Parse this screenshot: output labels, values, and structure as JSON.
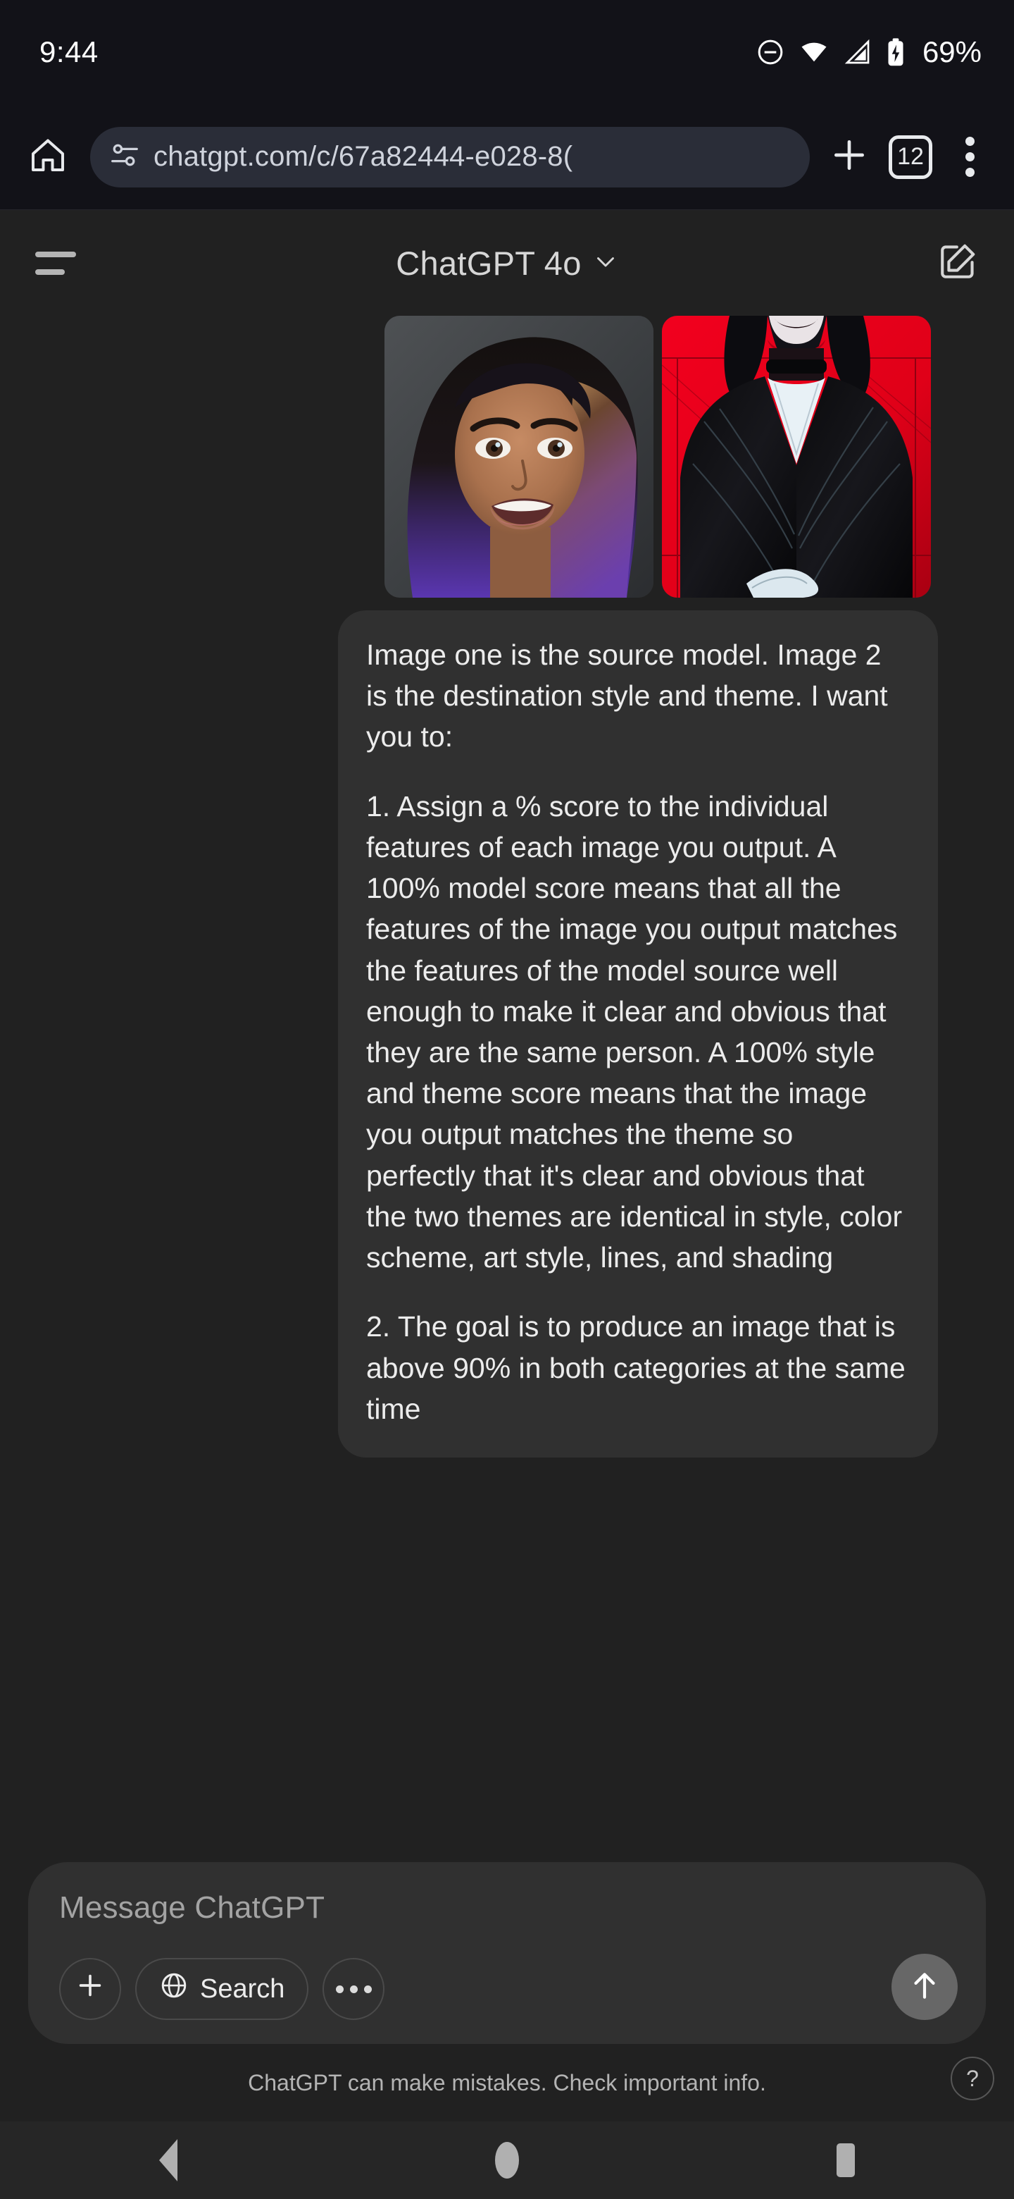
{
  "status_bar": {
    "time": "9:44",
    "battery_percent": "69%",
    "icons": [
      "do-not-disturb-icon",
      "wifi-icon",
      "cellular-signal-icon",
      "battery-charging-icon"
    ]
  },
  "browser": {
    "home_icon": "home-icon",
    "site_settings_icon": "tune-icon",
    "url": "chatgpt.com/c/67a82444-e028-8(",
    "new_tab_icon": "plus-icon",
    "tab_count": "12",
    "menu_icon": "kebab-menu-icon"
  },
  "app_header": {
    "menu_icon": "hamburger-icon",
    "title": "ChatGPT 4o",
    "chevron_icon": "chevron-down-icon",
    "new_chat_icon": "compose-pencil-icon"
  },
  "conversation": {
    "attachments": [
      {
        "name": "source-model-portrait",
        "alt": "Smiling woman with purple and pink ombre wavy hair on grey background"
      },
      {
        "name": "destination-style-comic",
        "alt": "Comic style figure in black coat with white shirt on red background"
      }
    ],
    "message_paragraphs": [
      "Image one is the source model. Image 2 is the destination style and theme. I want you to:",
      "1. Assign a % score to the individual features of each image you output. A 100% model score means that all the features of the image you output matches the features of the model source well enough to make it clear and obvious that they are the same person. A 100% style and theme score means that the image you output matches the theme so perfectly that it's clear and obvious that the two themes are identical in style, color scheme, art style, lines, and shading",
      "2. The goal is to produce an image that is above 90% in both categories at the same time"
    ],
    "scroll_to_bottom_icon": "arrow-down-icon"
  },
  "composer": {
    "placeholder": "Message ChatGPT",
    "add_icon": "plus-icon",
    "search_label": "Search",
    "search_icon": "globe-icon",
    "more_icon": "ellipsis-icon",
    "send_icon": "arrow-up-icon"
  },
  "footer": {
    "disclaimer": "ChatGPT can make mistakes. Check important info.",
    "help_label": "?"
  },
  "nav_bar": {
    "back_icon": "triangle-back-icon",
    "home_icon": "circle-home-icon",
    "recents_icon": "square-recents-icon"
  },
  "colors": {
    "status_bar_bg": "#121218",
    "app_bg": "#212121",
    "bubble_bg": "#303030",
    "omnibox_bg": "#2a2d38",
    "accent_text": "#ececec"
  }
}
